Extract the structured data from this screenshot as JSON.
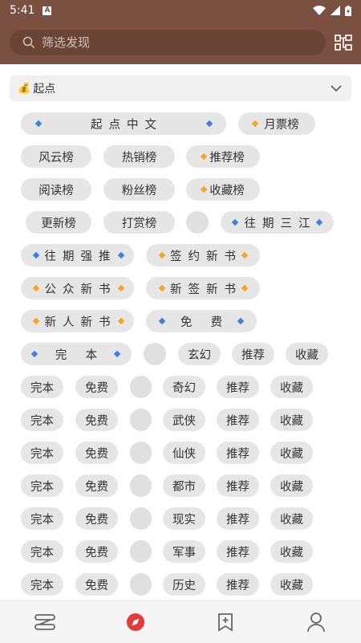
{
  "status_bar": {
    "time": "5:41",
    "notif_glyph": "A"
  },
  "header": {
    "search_placeholder": "筛选发现",
    "filter_icon": "filter-icon"
  },
  "category": {
    "title": "起点",
    "icon": "moneybag-icon"
  },
  "colors": {
    "brand": "#7a5141",
    "chip": "#e6e6e6",
    "dot_blue": "#3d7fe6",
    "dot_orange": "#f5a623"
  },
  "chips": {
    "r1": [
      "起点中文",
      "月票榜"
    ],
    "r2": [
      "风云榜",
      "热销榜",
      "推荐榜"
    ],
    "r3": [
      "阅读榜",
      "粉丝榜",
      "收藏榜"
    ],
    "r4": [
      "更新榜",
      "打赏榜",
      "",
      "往期三江"
    ],
    "r5": [
      "往期强推",
      "签约新书"
    ],
    "r6": [
      "公众新书",
      "新签新书"
    ],
    "r7": [
      "新人新书",
      "免费"
    ],
    "r8": [
      "完本",
      "",
      "玄幻",
      "推荐",
      "收藏"
    ]
  },
  "genre_rows": [
    [
      "完本",
      "免费",
      "",
      "奇幻",
      "推荐",
      "收藏"
    ],
    [
      "完本",
      "免费",
      "",
      "武侠",
      "推荐",
      "收藏"
    ],
    [
      "完本",
      "免费",
      "",
      "仙侠",
      "推荐",
      "收藏"
    ],
    [
      "完本",
      "免费",
      "",
      "都市",
      "推荐",
      "收藏"
    ],
    [
      "完本",
      "免费",
      "",
      "现实",
      "推荐",
      "收藏"
    ],
    [
      "完本",
      "免费",
      "",
      "军事",
      "推荐",
      "收藏"
    ],
    [
      "完本",
      "免费",
      "",
      "历史",
      "推荐",
      "收藏"
    ]
  ],
  "bottom_nav": [
    "bookshelf-icon",
    "discover-icon",
    "bookmark-add-icon",
    "profile-icon"
  ]
}
